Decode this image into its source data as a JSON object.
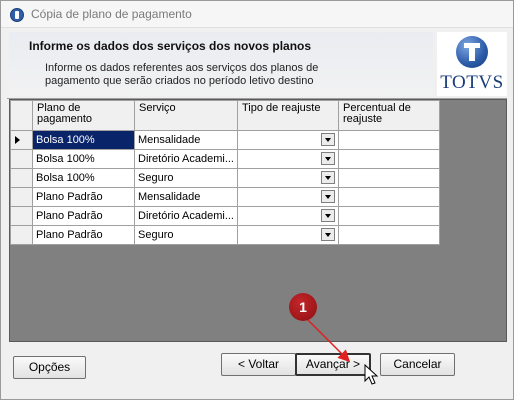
{
  "window": {
    "title": "Cópia de plano de pagamento"
  },
  "header": {
    "title": "Informe os dados dos serviços dos novos planos",
    "description": "Informe os dados referentes aos serviços dos planos de pagamento que serão criados no período letivo destino",
    "logo_text": "TOTVS"
  },
  "grid": {
    "columns": [
      "Plano de pagamento",
      "Serviço",
      "Tipo de reajuste",
      "Percentual de reajuste"
    ],
    "rows": [
      {
        "plano": "Bolsa 100%",
        "servico": "Mensalidade",
        "tipo": "",
        "percentual": ""
      },
      {
        "plano": "Bolsa 100%",
        "servico": "Diretório Academi...",
        "tipo": "",
        "percentual": ""
      },
      {
        "plano": "Bolsa 100%",
        "servico": "Seguro",
        "tipo": "",
        "percentual": ""
      },
      {
        "plano": "Plano Padrão",
        "servico": "Mensalidade",
        "tipo": "",
        "percentual": ""
      },
      {
        "plano": "Plano Padrão",
        "servico": "Diretório Academi...",
        "tipo": "",
        "percentual": ""
      },
      {
        "plano": "Plano Padrão",
        "servico": "Seguro",
        "tipo": "",
        "percentual": ""
      }
    ],
    "selected_row": 0
  },
  "buttons": {
    "opcoes": "Opções",
    "voltar": "< Voltar",
    "avancar": "Avançar >",
    "cancelar": "Cancelar"
  },
  "annotation": {
    "step": "1",
    "color": "#a8181c"
  }
}
